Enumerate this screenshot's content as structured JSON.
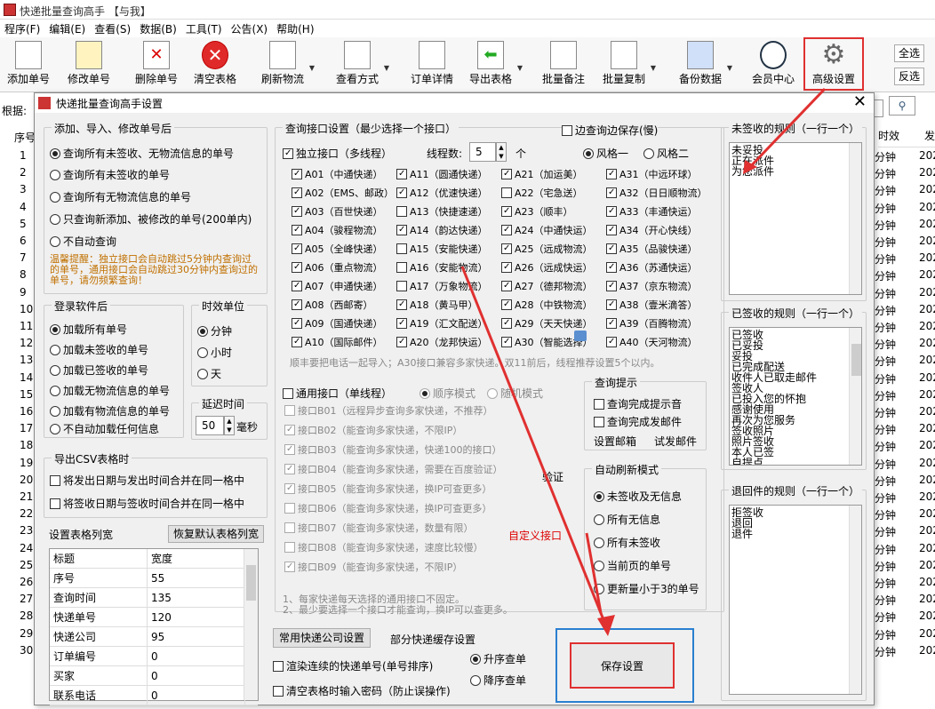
{
  "window_title": "快递批量查询高手 【与我】",
  "menu": [
    "程序(F)",
    "编辑(E)",
    "查看(S)",
    "数据(B)",
    "工具(T)",
    "公告(X)",
    "帮助(H)"
  ],
  "toolbar": {
    "add": "添加单号",
    "modify": "修改单号",
    "delete": "删除单号",
    "clear": "清空表格",
    "refresh": "刷新物流",
    "view": "查看方式",
    "detail": "订单详情",
    "export": "导出表格",
    "remark": "批量备注",
    "copy": "批量复制",
    "backup": "备份数据",
    "member": "会员中心",
    "advanced": "高级设置",
    "select_all": "全选",
    "invert": "反选"
  },
  "filter_label": "根据:",
  "grid": {
    "left_header": "序号",
    "row_numbers": [
      "1",
      "2",
      "3",
      "4",
      "5",
      "6",
      "7",
      "8",
      "9",
      "10",
      "11",
      "12",
      "13",
      "14",
      "15",
      "16",
      "17",
      "18",
      "19",
      "20",
      "21",
      "22",
      "23",
      "24",
      "25",
      "26",
      "27",
      "28",
      "29",
      "30"
    ],
    "right_headers": [
      "时效",
      "发"
    ],
    "right_cells": [
      "分钟",
      "分钟",
      "分钟",
      "分钟",
      "分钟",
      "分钟",
      "分钟",
      "分钟",
      "分钟",
      "分钟",
      "分钟",
      "分钟",
      "分钟",
      "分钟",
      "分钟",
      "分钟",
      "分钟",
      "分钟",
      "分钟",
      "分钟",
      "分钟",
      "分钟",
      "分钟",
      "分钟",
      "分钟",
      "分钟",
      "分钟",
      "分钟",
      "分钟",
      "分钟"
    ],
    "right_year": "202"
  },
  "dialog": {
    "title": "快递批量查询高手设置",
    "after_group": {
      "legend": "添加、导入、修改单号后",
      "options": [
        "查询所有未签收、无物流信息的单号",
        "查询所有未签收的单号",
        "查询所有无物流信息的单号",
        "只查询新添加、被修改的单号(200单内)",
        "不自动查询"
      ],
      "selected": 0,
      "tip": "温馨提醒：独立接口会自动跳过5分钟内查询过的单号，通用接口会自动跳过30分钟内查询过的单号，请勿频繁查询！"
    },
    "login_group": {
      "legend": "登录软件后",
      "options": [
        "加载所有单号",
        "加载未签收的单号",
        "加载已签收的单号",
        "加载无物流信息的单号",
        "加载有物流信息的单号",
        "不自动加载任何信息"
      ],
      "selected": 0
    },
    "time_unit": {
      "legend": "时效单位",
      "options": [
        "分钟",
        "小时",
        "天"
      ],
      "selected": 0
    },
    "delay": {
      "legend": "延迟时间",
      "value": "50",
      "unit": "毫秒"
    },
    "csv": {
      "legend": "导出CSV表格时",
      "options": [
        "将发出日期与发出时间合并在同一格中",
        "将签收日期与签收时间合并在同一格中"
      ]
    },
    "columns": {
      "legend": "设置表格列宽",
      "reset": "恢复默认表格列宽",
      "headers": [
        "标题",
        "宽度"
      ],
      "rows": [
        [
          "序号",
          "55"
        ],
        [
          "查询时间",
          "135"
        ],
        [
          "快递单号",
          "120"
        ],
        [
          "快递公司",
          "95"
        ],
        [
          "订单编号",
          "0"
        ],
        [
          "买家",
          "0"
        ],
        [
          "联系电话",
          "0"
        ]
      ]
    },
    "api": {
      "legend": "查询接口设置（最少选择一个接口）",
      "save_while": "边查询边保存(慢)",
      "independent": "独立接口（多线程）",
      "threads_label": "线程数:",
      "threads": "5",
      "threads_unit": "个",
      "styles": [
        "风格一",
        "风格二"
      ],
      "items": [
        [
          "A01（中通快递）",
          "A11（圆通快递）",
          "A21（加运美）",
          "A31（中远环球）"
        ],
        [
          "A02（EMS、邮政）",
          "A12（优速快递）",
          "A22（宅急送）",
          "A32（日日顺物流）"
        ],
        [
          "A03（百世快递）",
          "A13（快捷速递）",
          "A23（顺丰）",
          "A33（丰通快运）"
        ],
        [
          "A04（骏程物流）",
          "A14（韵达快递）",
          "A24（中通快运）",
          "A34（开心快线）"
        ],
        [
          "A05（全峰快递）",
          "A15（安能快递）",
          "A25（远成物流）",
          "A35（品骏快递）"
        ],
        [
          "A06（重点物流）",
          "A16（安能物流）",
          "A26（远成快运）",
          "A36（苏通快运）"
        ],
        [
          "A07（申通快递）",
          "A17（万象物流）",
          "A27（德邦物流）",
          "A37（京东物流）"
        ],
        [
          "A08（西邮寄）",
          "A18（黄马甲）",
          "A28（中铁物流）",
          "A38（壹米滴答）"
        ],
        [
          "A09（国通快递）",
          "A19（汇文配送）",
          "A29（天天快递）",
          "A39（百腾物流）"
        ],
        [
          "A10（国际邮件）",
          "A20（龙邦快运）",
          "A30（智能选择）",
          "A40（天河物流）"
        ]
      ],
      "unchecked": [
        "A13",
        "A15",
        "A16",
        "A17",
        "A22"
      ],
      "note": "顺丰要把电话一起导入；A30接口兼容多家快递。双11前后，线程推荐设置5个以内。",
      "general": "通用接口（单线程）",
      "modes": [
        "顺序模式",
        "随机模式"
      ],
      "general_items": [
        "接口B01（远程异步查询多家快递，不推荐）",
        "接口B02（能查询多家快递，不限IP）",
        "接口B03（能查询多家快递，快递100的接口）",
        "接口B04（能查询多家快递，需要在百度验证）",
        "接口B05（能查询多家快递，换IP可查更多）",
        "接口B06（能查询多家快递，换IP可查更多）",
        "接口B07（能查询多家快递，数量有限）",
        "接口B08（能查询多家快递，速度比较慢）",
        "接口B09（能查询多家快递，不限IP）"
      ],
      "verify": "验证",
      "custom": "自定义接口",
      "footnote1": "1、每家快递每天选择的通用接口不固定。",
      "footnote2": "2、最少要选择一个接口才能查询，换IP可以查更多。"
    },
    "hint": {
      "legend": "查询提示",
      "sound": "查询完成提示音",
      "mail": "查询完成发邮件",
      "set_mail": "设置邮箱",
      "test_mail": "试发邮件"
    },
    "auto_refresh": {
      "legend": "自动刷新模式",
      "options": [
        "未签收及无信息",
        "所有无信息",
        "所有未签收",
        "当前页的单号",
        "更新量小于3的单号"
      ],
      "selected": 0
    },
    "common_set": "常用快递公司设置",
    "partial_cache": "部分快递缓存设置",
    "render_cont": "渲染连续的快递单号(单号排序)",
    "clear_pwd": "清空表格时输入密码（防止误操作)",
    "sort": [
      "升序查单",
      "降序查单"
    ],
    "save": "保存设置",
    "unsigned_rules": {
      "legend": "未签收的规则（一行一个）",
      "lines": [
        "未妥投",
        "正在派件",
        "为您派件"
      ]
    },
    "signed_rules": {
      "legend": "已签收的规则（一行一个）",
      "lines": [
        "已签收",
        "已妥投",
        "妥投",
        "已完成配送",
        "收件人已取走邮件",
        "签收人",
        "已投入您的怀抱",
        "感谢使用",
        "再次为您服务",
        "签收照片",
        "照片签收",
        "本人已签",
        "自提点"
      ]
    },
    "returned_rules": {
      "legend": "退回件的规则（一行一个）",
      "lines": [
        "拒签收",
        "退回",
        "退件"
      ]
    }
  }
}
